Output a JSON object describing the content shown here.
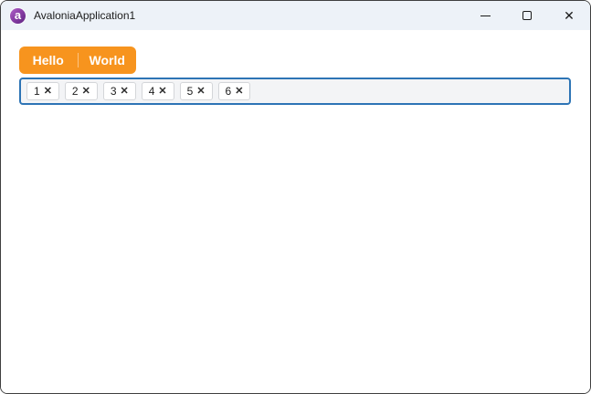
{
  "window": {
    "title": "AvaloniaApplication1",
    "logo_glyph": "a",
    "titlebar_bg": "#EDF2F8",
    "border_color": "#3F3F3F",
    "controls": {
      "minimize_label": "Minimize",
      "maximize_label": "Maximize",
      "close_label": "Close",
      "close_glyph": "✕"
    }
  },
  "toolbar": {
    "accent_color": "#F7941E",
    "buttons": [
      {
        "label": "Hello"
      },
      {
        "label": "World"
      }
    ]
  },
  "tag_input": {
    "border_color": "#2D74B5",
    "background": "#F3F4F6",
    "remove_glyph": "✕",
    "tags": [
      {
        "value": "1"
      },
      {
        "value": "2"
      },
      {
        "value": "3"
      },
      {
        "value": "4"
      },
      {
        "value": "5"
      },
      {
        "value": "6"
      }
    ]
  }
}
